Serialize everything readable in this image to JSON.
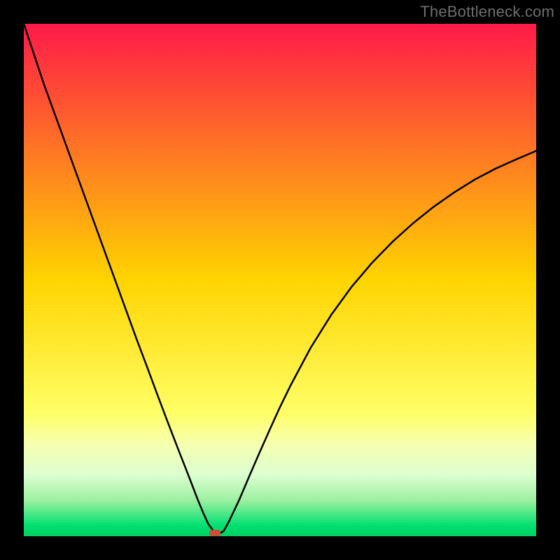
{
  "watermark": "TheBottleneck.com",
  "chart_data": {
    "type": "line",
    "title": "",
    "xlabel": "",
    "ylabel": "",
    "xlim": [
      0,
      100
    ],
    "ylim": [
      0,
      100
    ],
    "grid": false,
    "legend": false,
    "background_gradient": {
      "stops": [
        {
          "offset": 0,
          "color": "#ff1a48"
        },
        {
          "offset": 50,
          "color": "#ffd400"
        },
        {
          "offset": 76,
          "color": "#ffff66"
        },
        {
          "offset": 82,
          "color": "#f6ffb0"
        },
        {
          "offset": 88,
          "color": "#dcffd0"
        },
        {
          "offset": 93,
          "color": "#9cf0a0"
        },
        {
          "offset": 98,
          "color": "#00e070"
        },
        {
          "offset": 100,
          "color": "#00d060"
        }
      ]
    },
    "series": [
      {
        "name": "bottleneck-curve",
        "color": "#000000",
        "stroke_width": 2.5,
        "x": [
          0,
          2,
          4,
          6,
          8,
          10,
          12,
          14,
          16,
          18,
          20,
          22,
          24,
          26,
          28,
          30,
          32,
          34,
          35,
          36,
          37,
          38,
          39,
          40,
          42,
          44,
          46,
          48,
          50,
          52,
          56,
          60,
          64,
          68,
          72,
          76,
          80,
          84,
          88,
          92,
          96,
          100
        ],
        "y": [
          100,
          94,
          88,
          82.5,
          77,
          71.5,
          66,
          60.5,
          55,
          49.5,
          44,
          38.5,
          33.2,
          27.8,
          22.5,
          17.3,
          12.2,
          7,
          4.6,
          2.4,
          1.0,
          0.4,
          1.0,
          2.8,
          7,
          11.7,
          16.3,
          20.8,
          25.2,
          29.3,
          36.8,
          43.2,
          48.7,
          53.4,
          57.5,
          61.1,
          64.3,
          67.1,
          69.6,
          71.7,
          73.5,
          75.2
        ]
      }
    ],
    "marker": {
      "name": "optimal-point",
      "x": 37.3,
      "y": 0.6,
      "width": 2.2,
      "height": 1.3,
      "color": "#cc4d3d"
    }
  }
}
